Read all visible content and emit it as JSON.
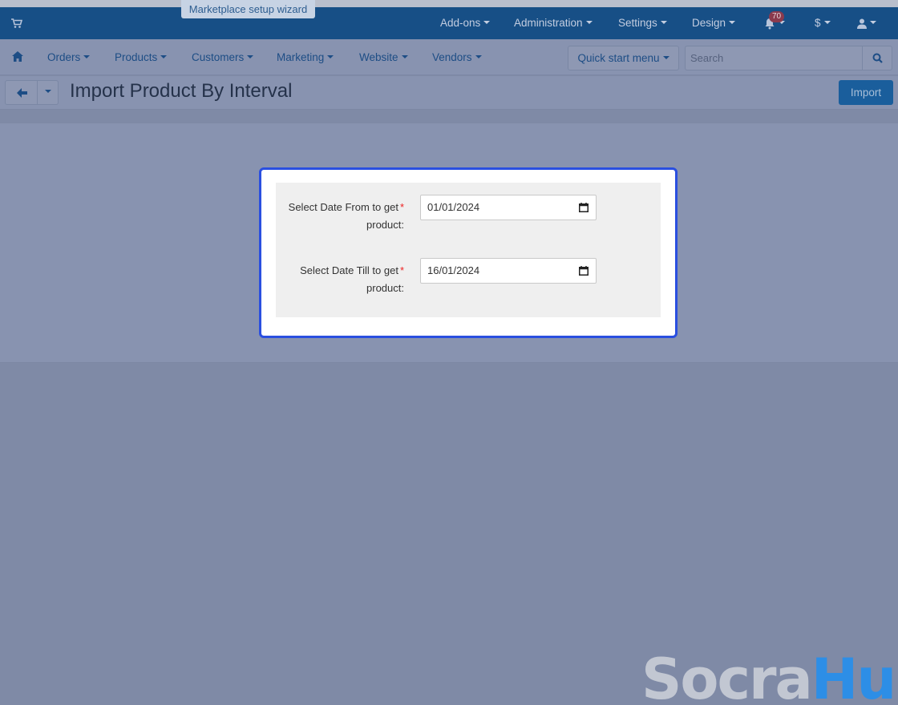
{
  "topbar": {
    "wizard_label": "Marketplace setup wizard",
    "addons": "Add-ons",
    "administration": "Administration",
    "settings": "Settings",
    "design": "Design",
    "notifications_count": "70",
    "currency": "$"
  },
  "navbar": {
    "items": [
      "Orders",
      "Products",
      "Customers",
      "Marketing",
      "Website",
      "Vendors"
    ],
    "quick_start": "Quick start menu",
    "search_placeholder": "Search"
  },
  "page": {
    "title": "Import Product By Interval",
    "import_button": "Import"
  },
  "form": {
    "date_from_label_line1": "Select Date From to get",
    "date_from_label_line2": "product:",
    "date_from_value": "01/01/2024",
    "date_till_label_line1": "Select Date Till to get",
    "date_till_label_line2": "product:",
    "date_till_value": "16/01/2024",
    "required_mark": "*"
  },
  "watermark": {
    "part1": "Socra",
    "part2": "Hub"
  },
  "colors": {
    "topbar": "#174f86",
    "accent_border": "#2a4fe0",
    "import_button": "#1a5e9c"
  }
}
